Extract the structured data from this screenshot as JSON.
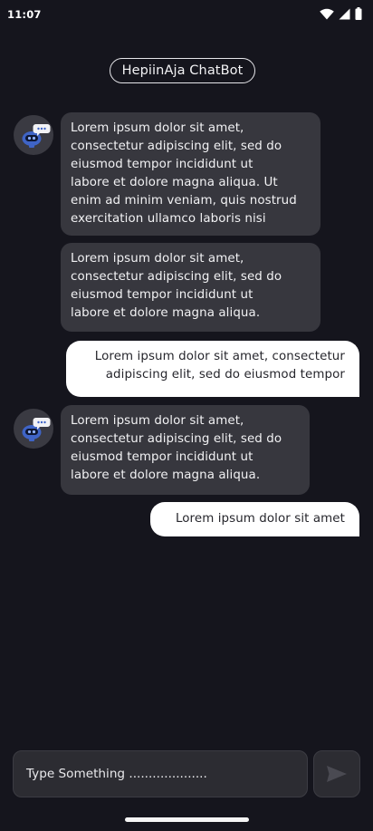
{
  "status_bar": {
    "time": "11:07",
    "icons": [
      "wifi-icon",
      "cellular-signal-icon",
      "battery-icon"
    ]
  },
  "header": {
    "title": "HepiinAja ChatBot"
  },
  "messages": [
    {
      "sender": "bot",
      "text": "Lorem ipsum dolor sit amet,\nconsectetur adipiscing elit, sed do\neiusmod tempor incididunt ut\nlabore et dolore magna aliqua. Ut\nenim ad minim veniam, quis nostrud\nexercitation ullamco laboris nisi"
    },
    {
      "sender": "bot",
      "text": "Lorem ipsum dolor sit amet,\nconsectetur adipiscing elit, sed do\neiusmod tempor incididunt ut\nlabore et dolore magna aliqua."
    },
    {
      "sender": "user",
      "text": "Lorem ipsum dolor sit amet, consectetur\nadipiscing elit, sed do eiusmod tempor"
    },
    {
      "sender": "bot",
      "text": "Lorem ipsum dolor sit amet,\nconsectetur adipiscing elit, sed do\neiusmod tempor incididunt ut\nlabore et dolore magna aliqua."
    },
    {
      "sender": "user",
      "text": "Lorem ipsum dolor sit amet"
    }
  ],
  "composer": {
    "placeholder": "Type Something ....................",
    "send_icon": "send-icon"
  },
  "colors": {
    "background": "#15151d",
    "bot_bubble": "#37373e",
    "user_bubble": "#ffffff",
    "input_background": "#2c2c32"
  }
}
